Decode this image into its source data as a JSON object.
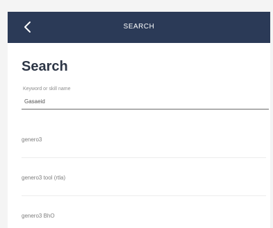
{
  "header": {
    "back_icon": "chevron-left-icon",
    "title": "SEARCH"
  },
  "page": {
    "heading": "Search"
  },
  "search": {
    "label": "Keyword or skill name",
    "value": "Gasaeid"
  },
  "results": [
    {
      "label": "genero3"
    },
    {
      "label": "genero3 tool (rtla)"
    },
    {
      "label": "genero3 BhO"
    }
  ],
  "colors": {
    "header_bg": "#2b3a57",
    "heading_text": "#2d3646"
  }
}
